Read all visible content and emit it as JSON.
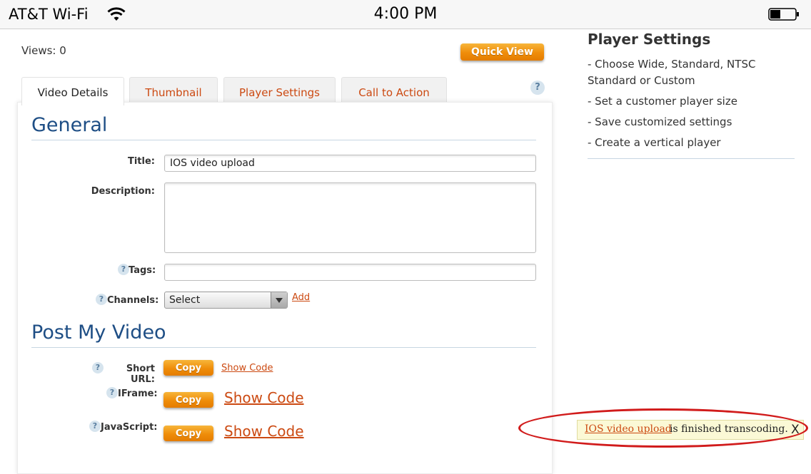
{
  "status_bar": {
    "carrier": "AT&T Wi-Fi",
    "time": "4:00 PM",
    "wifi_icon": "wifi-icon",
    "battery_icon": "battery-icon"
  },
  "header": {
    "views": "Views: 0",
    "quick_view": "Quick View",
    "help": "?"
  },
  "tabs": [
    {
      "label": "Video Details",
      "active": true
    },
    {
      "label": "Thumbnail",
      "active": false
    },
    {
      "label": "Player Settings",
      "active": false
    },
    {
      "label": "Call to Action",
      "active": false
    }
  ],
  "general": {
    "heading": "General",
    "title_label": "Title:",
    "title_value": "IOS video upload",
    "description_label": "Description:",
    "description_value": "",
    "tags_label": "Tags:",
    "tags_value": "",
    "channels_label": "Channels:",
    "channels_selected": "Select",
    "add_link": "Add"
  },
  "post": {
    "heading": "Post My Video",
    "rows": [
      {
        "label": "Short URL:",
        "copy": "Copy",
        "show_code": "Show Code"
      },
      {
        "label": "IFrame:",
        "copy": "Copy",
        "show_code": "Show Code"
      },
      {
        "label": "JavaScript:",
        "copy": "Copy",
        "show_code": "Show Code"
      }
    ]
  },
  "sidebar": {
    "title": "Player Settings",
    "items": [
      "- Choose Wide, Standard, NTSC Standard or Custom",
      "- Set a customer player size",
      "- Save customized settings",
      "- Create a vertical player"
    ]
  },
  "notification": {
    "link": "IOS video upload",
    "message": "is finished transcoding.",
    "close": "X"
  },
  "colors": {
    "accent_orange": "#ef8d0a",
    "link_orange": "#cc4a12",
    "heading_blue": "#1e4e85",
    "highlight_red": "#d11b1b"
  }
}
